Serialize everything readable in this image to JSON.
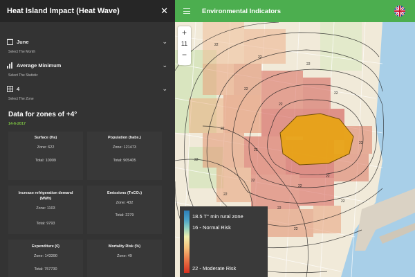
{
  "sidebar": {
    "title": "Heat Island Impact (Heat Wave)",
    "close_icon": "close-icon",
    "month": {
      "value": "June",
      "caption": "Select The Month",
      "icon": "calendar-icon"
    },
    "statistic": {
      "value": "Average Minimum",
      "caption": "Select The Statistic",
      "icon": "bar-chart-icon"
    },
    "zone": {
      "value": "4",
      "caption": "Select The Zone",
      "icon": "grid-icon"
    },
    "data_title": "Data for zones of +4°",
    "data_date": "14-6-2017",
    "cards": [
      {
        "title": "Surface (Ha)",
        "zone": "Zone: 622",
        "total": "Total: 10909"
      },
      {
        "title": "Population (habs.)",
        "zone": "Zone: 121473",
        "total": "Total: 905405"
      },
      {
        "title": "Increase refrigeration demand (MWh)",
        "zone": "Zone: 1103",
        "total": "Total: 9793"
      },
      {
        "title": "Emissions (TnCO₂)",
        "zone": "Zone: 432",
        "total": "Total: 2279"
      },
      {
        "title": "Expenditure (€)",
        "zone": "Zone: 143390",
        "total": "Total: 757730"
      },
      {
        "title": "Mortality Risk (%)",
        "zone": "Zone: 49",
        "total": ""
      }
    ]
  },
  "topbar": {
    "title": "Environmental Indicators",
    "menu_icon": "hamburger-menu-icon",
    "flag": "uk-flag-icon"
  },
  "map": {
    "zoom_in": "+",
    "zoom_level": "11",
    "zoom_out": "−",
    "legend": {
      "top": "18.5 T° min rural zone",
      "mid": "16 - Normal Risk",
      "bottom": "22 - Moderate Risk"
    }
  },
  "colors": {
    "topbar": "#4cae4f",
    "sidebar": "#333333",
    "date": "#7cc242",
    "hotspot": "#e8a317"
  }
}
